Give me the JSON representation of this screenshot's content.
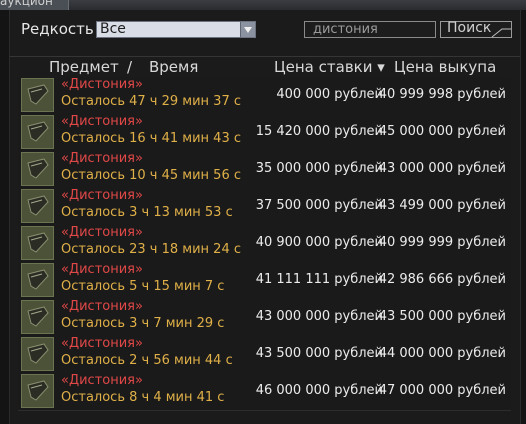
{
  "window": {
    "title": "аукцион"
  },
  "filters": {
    "rarity_label": "Редкость",
    "rarity_value": "Все",
    "search_value": "дистония",
    "search_button": "Поиск"
  },
  "table": {
    "col_item": "Предмет",
    "col_sep": "/",
    "col_time": "Время",
    "col_bid": "Цена ставки",
    "col_bid_sort": "▾",
    "col_buyout": "Цена выкупа"
  },
  "rows": [
    {
      "name": "«Дистония»",
      "time": "Осталось 47 ч 29 мин 37 с",
      "bid": "400 000 рублей",
      "buyout": "40 999 998 рублей"
    },
    {
      "name": "«Дистония»",
      "time": "Осталось 16 ч 41 мин 43 с",
      "bid": "15 420 000 рублей",
      "buyout": "45 000 000 рублей"
    },
    {
      "name": "«Дистония»",
      "time": "Осталось 10 ч 45 мин 56 с",
      "bid": "35 000 000 рублей",
      "buyout": "43 000 000 рублей"
    },
    {
      "name": "«Дистония»",
      "time": "Осталось 3 ч 13 мин 53 с",
      "bid": "37 500 000 рублей",
      "buyout": "43 499 000 рублей"
    },
    {
      "name": "«Дистония»",
      "time": "Осталось 23 ч 18 мин 24 с",
      "bid": "40 900 000 рублей",
      "buyout": "40 999 999 рублей"
    },
    {
      "name": "«Дистония»",
      "time": "Осталось 5 ч 15 мин 7 с",
      "bid": "41 111 111 рублей",
      "buyout": "42 986 666 рублей"
    },
    {
      "name": "«Дистония»",
      "time": "Осталось 3 ч 7 мин 29 с",
      "bid": "43 000 000 рублей",
      "buyout": "43 500 000 рублей"
    },
    {
      "name": "«Дистония»",
      "time": "Осталось 2 ч 56 мин 44 с",
      "bid": "43 500 000 рублей",
      "buyout": "44 000 000 рублей"
    },
    {
      "name": "«Дистония»",
      "time": "Осталось 8 ч 4 мин 41 с",
      "bid": "46 000 000 рублей",
      "buyout": "47 000 000 рублей"
    }
  ]
}
